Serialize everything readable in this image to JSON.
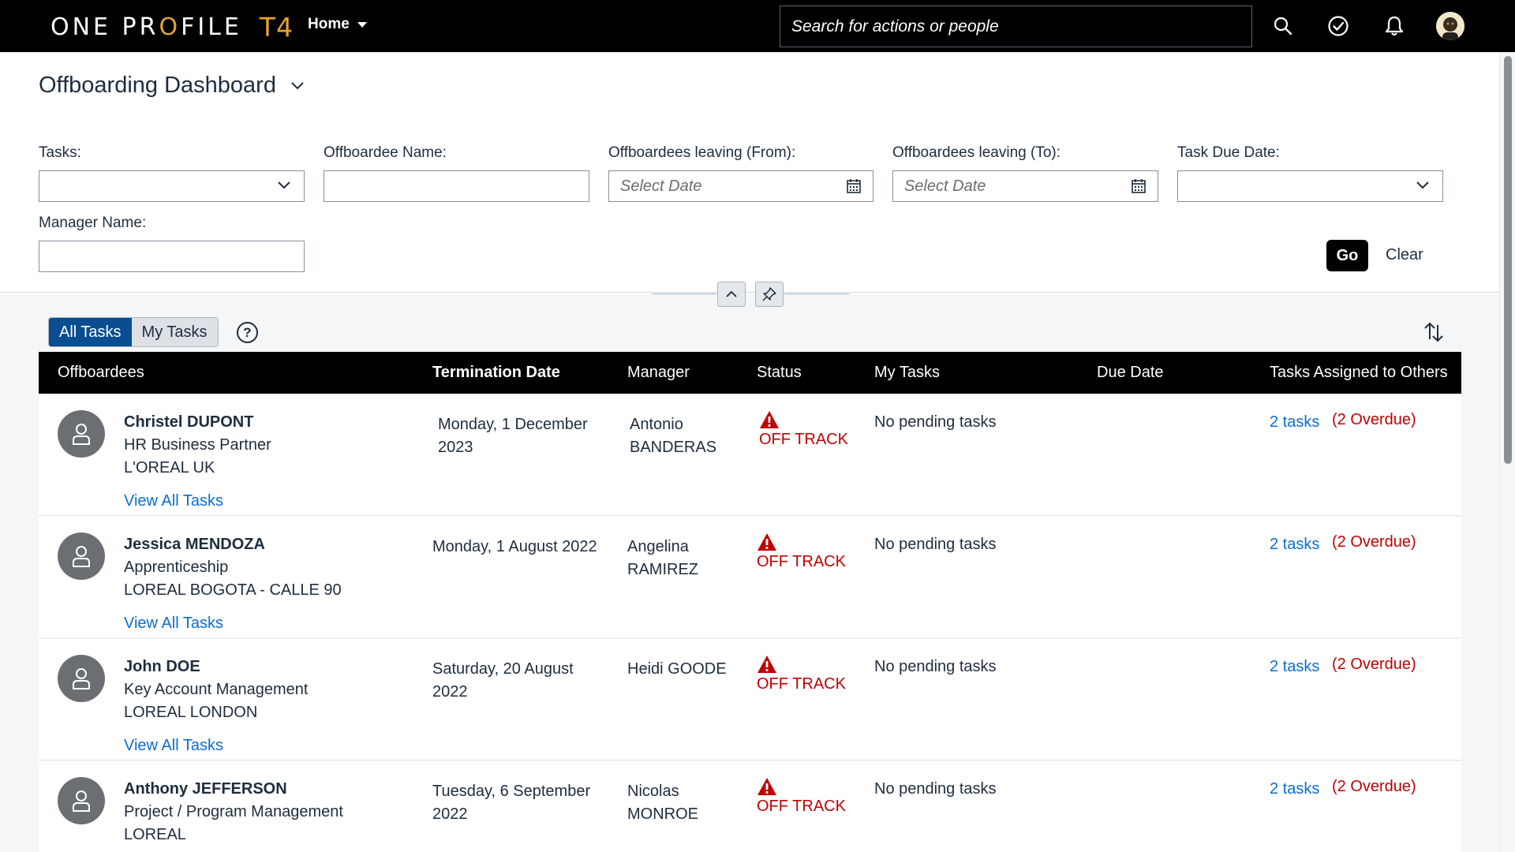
{
  "shell": {
    "logo_text_1": "ONE PR",
    "logo_text_o": "O",
    "logo_text_2": "FILE",
    "logo_t4": "T4",
    "home_label": "Home",
    "search_placeholder": "Search for actions or people",
    "icons": [
      "search-icon",
      "check-circle-icon",
      "bell-icon",
      "user-avatar"
    ]
  },
  "header": {
    "title": "Offboarding Dashboard",
    "filters": {
      "tasks_label": "Tasks:",
      "offboardee_name_label": "Offboardee Name:",
      "leaving_from_label": "Offboardees leaving (From):",
      "leaving_from_placeholder": "Select Date",
      "leaving_to_label": "Offboardees leaving (To):",
      "leaving_to_placeholder": "Select Date",
      "task_due_date_label": "Task Due Date:",
      "manager_name_label": "Manager Name:"
    },
    "go_label": "Go",
    "clear_label": "Clear"
  },
  "toolbar": {
    "all_tasks": "All Tasks",
    "my_tasks": "My Tasks",
    "help": "?"
  },
  "table": {
    "columns": {
      "offboardees": "Offboardees",
      "termination_date": "Termination Date",
      "manager": "Manager",
      "status": "Status",
      "my_tasks": "My Tasks",
      "due_date": "Due Date",
      "tasks_assigned": "Tasks Assigned to Others"
    },
    "view_all_label": "View All Tasks",
    "rows": [
      {
        "name": "Christel DUPONT",
        "title": "HR Business Partner",
        "org": "L'OREAL UK",
        "termination_line1": "Monday, 1 December",
        "termination_line2": "2023",
        "manager_line1": "Antonio",
        "manager_line2": "BANDERAS",
        "status": "OFF TRACK",
        "my_tasks": "No pending tasks",
        "tasks": "2 tasks",
        "overdue": "(2 Overdue)"
      },
      {
        "name": "Jessica MENDOZA",
        "title": "Apprenticeship",
        "org": "LOREAL BOGOTA - CALLE 90",
        "termination_line1": "Monday, 1 August 2022",
        "termination_line2": "",
        "manager_line1": "Angelina",
        "manager_line2": "RAMIREZ",
        "status": "OFF TRACK",
        "my_tasks": "No pending tasks",
        "tasks": "2 tasks",
        "overdue": "(2 Overdue)"
      },
      {
        "name": "John DOE",
        "title": "Key Account Management",
        "org": "LOREAL LONDON",
        "termination_line1": "Saturday, 20 August",
        "termination_line2": "2022",
        "manager_line1": "Heidi GOODE",
        "manager_line2": "",
        "status": "OFF TRACK",
        "my_tasks": "No pending tasks",
        "tasks": "2 tasks",
        "overdue": "(2 Overdue)"
      },
      {
        "name": "Anthony JEFFERSON",
        "title": "Project / Program Management",
        "org": "LOREAL",
        "termination_line1": "Tuesday, 6 September",
        "termination_line2": "2022",
        "manager_line1": "Nicolas",
        "manager_line2": "MONROE",
        "status": "OFF TRACK",
        "my_tasks": "No pending tasks",
        "tasks": "2 tasks",
        "overdue": "(2 Overdue)"
      }
    ]
  },
  "colors": {
    "shell_bg": "#000000",
    "logo_accent": "#e3a530",
    "link": "#0a6ed1",
    "status_error": "#c00000",
    "segmented_active": "#0a4d91"
  }
}
